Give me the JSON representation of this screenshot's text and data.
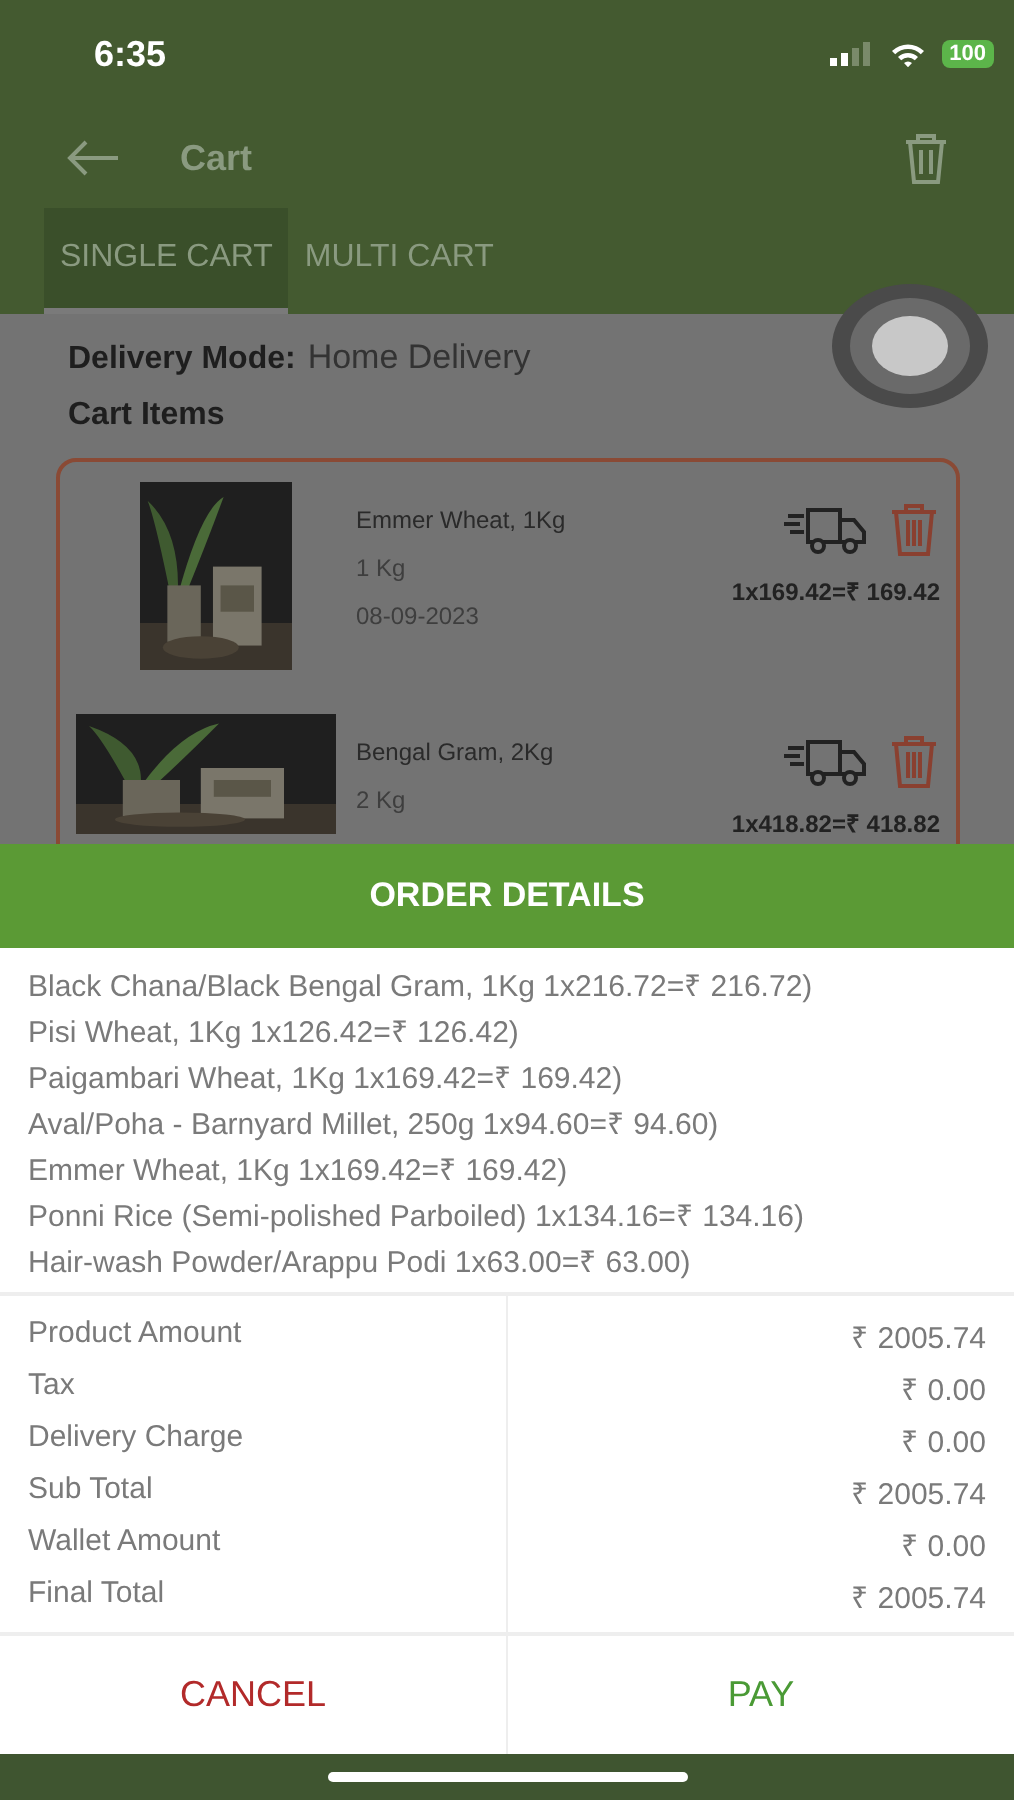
{
  "status_bar": {
    "time": "6:35",
    "battery": "100"
  },
  "app_bar": {
    "title": "Cart"
  },
  "tabs": [
    {
      "label": "SINGLE CART",
      "selected": true
    },
    {
      "label": "MULTI CART",
      "selected": false
    }
  ],
  "delivery_mode": {
    "label": "Delivery Mode:",
    "value": "Home Delivery"
  },
  "cart_items_heading": "Cart Items",
  "cart_items": [
    {
      "name": "Emmer Wheat, 1Kg",
      "unit": "1 Kg",
      "date": "08-09-2023",
      "price": "1x169.42=₹ 169.42"
    },
    {
      "name": "Bengal Gram, 2Kg",
      "unit": "2 Kg",
      "price": "1x418.82=₹ 418.82"
    }
  ],
  "order_details": {
    "title": "ORDER DETAILS",
    "lines": [
      "Black Chana/Black Bengal Gram, 1Kg 1x216.72=₹ 216.72)",
      "Pisi Wheat, 1Kg 1x126.42=₹ 126.42)",
      "Paigambari Wheat, 1Kg 1x169.42=₹ 169.42)",
      "Aval/Poha - Barnyard Millet, 250g 1x94.60=₹ 94.60)",
      "Emmer Wheat, 1Kg 1x169.42=₹ 169.42)",
      "Ponni Rice (Semi-polished Parboiled) 1x134.16=₹ 134.16)",
      "Hair-wash Powder/Arappu Podi 1x63.00=₹ 63.00)"
    ]
  },
  "totals": [
    {
      "label": "Product Amount",
      "value": "₹ 2005.74"
    },
    {
      "label": "Tax",
      "value": "₹ 0.00"
    },
    {
      "label": "Delivery Charge",
      "value": "₹ 0.00"
    },
    {
      "label": "Sub Total",
      "value": "₹ 2005.74"
    },
    {
      "label": "Wallet Amount",
      "value": "₹ 0.00"
    },
    {
      "label": "Final Total",
      "value": "₹ 2005.74"
    }
  ],
  "buttons": [
    {
      "label": "CANCEL",
      "kind": "cancel"
    },
    {
      "label": "PAY",
      "kind": "pay"
    }
  ]
}
